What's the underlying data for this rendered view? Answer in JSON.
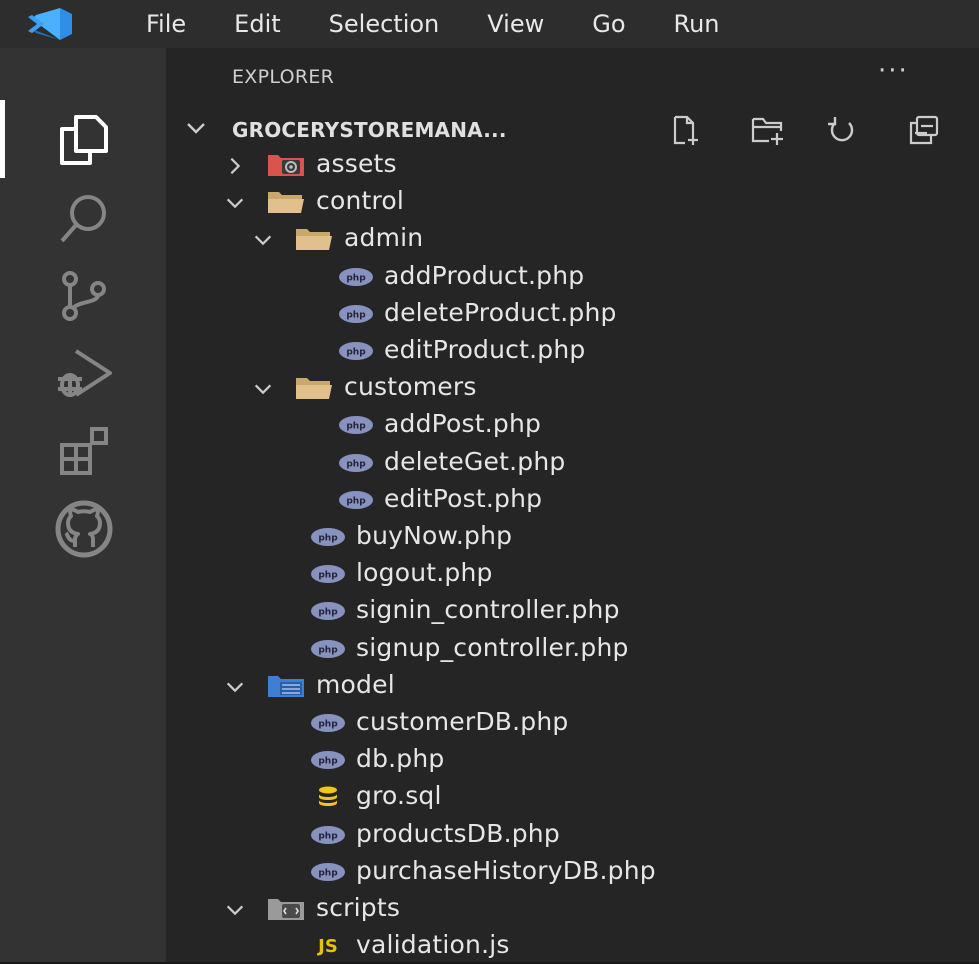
{
  "menubar": {
    "items": [
      "File",
      "Edit",
      "Selection",
      "View",
      "Go",
      "Run"
    ]
  },
  "activitybar": {
    "icons": [
      "explorer-icon",
      "search-icon",
      "source-control-icon",
      "run-debug-icon",
      "extensions-icon",
      "github-icon"
    ]
  },
  "explorer": {
    "title": "EXPLORER",
    "more": "···",
    "root": "GROCERYSTOREMANA...",
    "root_actions": [
      "new-file-icon",
      "new-folder-icon",
      "refresh-icon",
      "collapse-all-icon"
    ]
  },
  "tree": [
    {
      "label": "assets",
      "type": "folder",
      "depth": 1,
      "expanded": false,
      "icon": "assets-folder-icon",
      "color": "#d9534f"
    },
    {
      "label": "control",
      "type": "folder",
      "depth": 1,
      "expanded": true,
      "icon": "folder-open-icon",
      "color": "#e2c08d"
    },
    {
      "label": "admin",
      "type": "folder",
      "depth": 2,
      "expanded": true,
      "icon": "folder-open-icon",
      "color": "#e2c08d"
    },
    {
      "label": "addProduct.php",
      "type": "file",
      "depth": 3,
      "icon": "php-icon"
    },
    {
      "label": "deleteProduct.php",
      "type": "file",
      "depth": 3,
      "icon": "php-icon"
    },
    {
      "label": "editProduct.php",
      "type": "file",
      "depth": 3,
      "icon": "php-icon"
    },
    {
      "label": "customers",
      "type": "folder",
      "depth": 2,
      "expanded": true,
      "icon": "folder-open-icon",
      "color": "#e2c08d"
    },
    {
      "label": "addPost.php",
      "type": "file",
      "depth": 3,
      "icon": "php-icon"
    },
    {
      "label": "deleteGet.php",
      "type": "file",
      "depth": 3,
      "icon": "php-icon"
    },
    {
      "label": "editPost.php",
      "type": "file",
      "depth": 3,
      "icon": "php-icon"
    },
    {
      "label": "buyNow.php",
      "type": "file",
      "depth": 2,
      "icon": "php-icon"
    },
    {
      "label": "logout.php",
      "type": "file",
      "depth": 2,
      "icon": "php-icon"
    },
    {
      "label": "signin_controller.php",
      "type": "file",
      "depth": 2,
      "icon": "php-icon"
    },
    {
      "label": "signup_controller.php",
      "type": "file",
      "depth": 2,
      "icon": "php-icon"
    },
    {
      "label": "model",
      "type": "folder",
      "depth": 1,
      "expanded": true,
      "icon": "model-folder-icon",
      "color": "#3f7fd1"
    },
    {
      "label": "customerDB.php",
      "type": "file",
      "depth": 2,
      "icon": "php-icon"
    },
    {
      "label": "db.php",
      "type": "file",
      "depth": 2,
      "icon": "php-icon"
    },
    {
      "label": "gro.sql",
      "type": "file",
      "depth": 2,
      "icon": "database-icon"
    },
    {
      "label": "productsDB.php",
      "type": "file",
      "depth": 2,
      "icon": "php-icon"
    },
    {
      "label": "purchaseHistoryDB.php",
      "type": "file",
      "depth": 2,
      "icon": "php-icon"
    },
    {
      "label": "scripts",
      "type": "folder",
      "depth": 1,
      "expanded": true,
      "icon": "scripts-folder-icon",
      "color": "#9a9a9a"
    },
    {
      "label": "validation.js",
      "type": "file",
      "depth": 2,
      "icon": "js-icon",
      "badge": "JS"
    }
  ],
  "colors": {
    "accent_logo": "#3aa0f3",
    "php_icon": "#8892bf",
    "db_icon": "#f0c419",
    "js_icon": "#e6c300"
  }
}
